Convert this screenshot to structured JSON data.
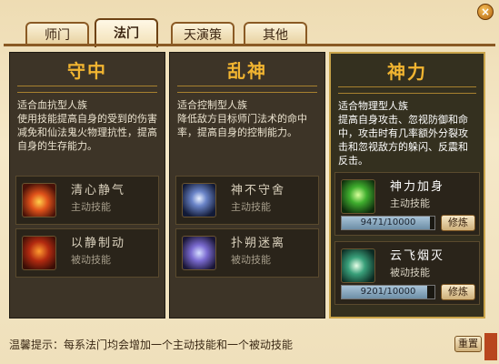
{
  "window": {
    "close_label": "×"
  },
  "tabs": [
    {
      "label": "师门",
      "active": false
    },
    {
      "label": "法门",
      "active": true
    },
    {
      "label": "天演策",
      "active": false
    },
    {
      "label": "其他",
      "active": false
    }
  ],
  "columns": [
    {
      "title": "守中",
      "description": "适合血抗型人族\n使用技能提高自身的受到的伤害减免和仙法鬼火物理抗性，提高自身的生存能力。",
      "skills": [
        {
          "name": "清心静气",
          "type": "主动技能",
          "icon": "fire-aura-icon"
        },
        {
          "name": "以静制动",
          "type": "被动技能",
          "icon": "flame-figure-icon"
        }
      ]
    },
    {
      "title": "乱神",
      "description": "适合控制型人族\n降低敌方目标师门法术的命中率，提高自身的控制能力。",
      "skills": [
        {
          "name": "神不守舍",
          "type": "主动技能",
          "icon": "ghost-figure-icon"
        },
        {
          "name": "扑朔迷离",
          "type": "被动技能",
          "icon": "sparkle-figure-icon"
        }
      ]
    },
    {
      "title": "神力",
      "description": "适合物理型人族\n提高自身攻击、忽视防御和命中，攻击时有几率额外分裂攻击和忽视敌方的躲闪、反震和反击。",
      "skills": [
        {
          "name": "神力加身",
          "type": "主动技能",
          "icon": "green-power-icon",
          "progress_text": "9471/10000",
          "progress": 0.9471,
          "train_label": "修炼"
        },
        {
          "name": "云飞烟灭",
          "type": "被动技能",
          "icon": "green-sword-icon",
          "progress_text": "9201/10000",
          "progress": 0.9201,
          "train_label": "修炼"
        }
      ]
    }
  ],
  "footer": {
    "tip": "温馨提示：每系法门均会增加一个主动技能和一个被动技能",
    "reset_label": "重置"
  }
}
